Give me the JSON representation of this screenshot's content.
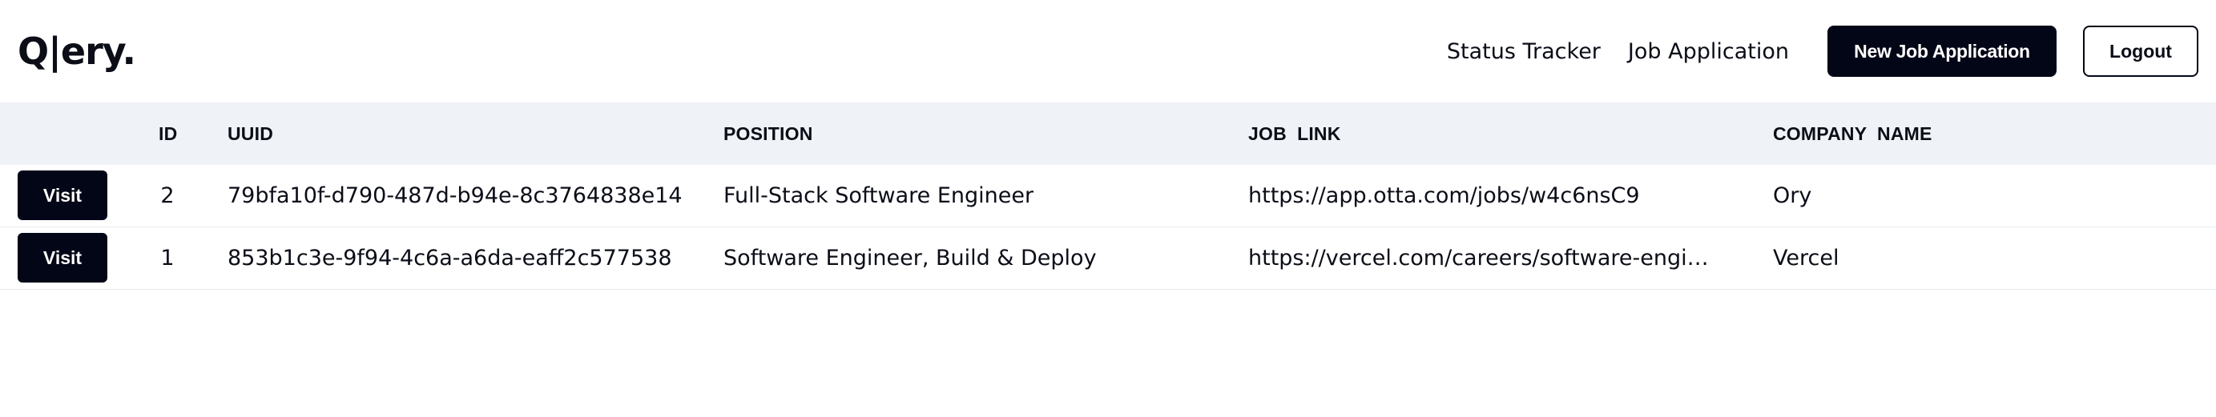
{
  "header": {
    "logo": "Q|ery.",
    "nav": {
      "status_tracker": "Status Tracker",
      "job_application": "Job Application"
    },
    "new_job_button": "New Job Application",
    "logout_button": "Logout"
  },
  "table": {
    "columns": [
      "ID",
      "UUID",
      "POSITION",
      "JOB  LINK",
      "COMPANY  NAME"
    ],
    "rows": [
      {
        "action": "Visit",
        "id": "2",
        "uuid": "79bfa10f-d790-487d-b94e-8c3764838e14",
        "position": "Full-Stack Software Engineer",
        "job_link": "https://app.otta.com/jobs/w4c6nsC9",
        "company": "Ory"
      },
      {
        "action": "Visit",
        "id": "1",
        "uuid": "853b1c3e-9f94-4c6a-a6da-eaff2c577538",
        "position": "Software Engineer, Build & Deploy",
        "job_link": "https://vercel.com/careers/software-engineer...",
        "company": "Vercel"
      }
    ]
  },
  "colors": {
    "primary": "#030616",
    "header_row_bg": "#eff2f6",
    "row_border": "#e6e8ec"
  }
}
